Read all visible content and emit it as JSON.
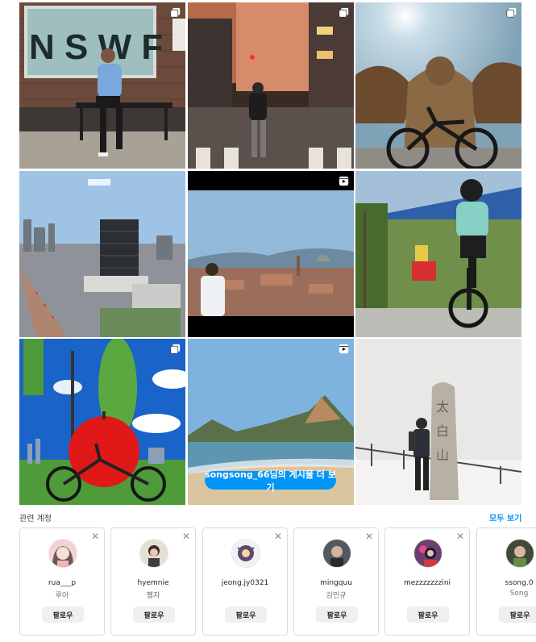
{
  "grid": {
    "posts": [
      {
        "id": "post-1",
        "badge": "carousel-icon",
        "alt_sign": "NSWF"
      },
      {
        "id": "post-2",
        "badge": "carousel-icon"
      },
      {
        "id": "post-3",
        "badge": "carousel-icon"
      },
      {
        "id": "post-4",
        "badge": ""
      },
      {
        "id": "post-5",
        "badge": "reels-icon"
      },
      {
        "id": "post-6",
        "badge": ""
      },
      {
        "id": "post-7",
        "badge": "carousel-icon"
      },
      {
        "id": "post-8",
        "badge": "reels-icon"
      },
      {
        "id": "post-9",
        "badge": ""
      }
    ],
    "more_posts_label": "songsong_66님의 게시물 더 보기"
  },
  "related": {
    "title": "관련 계정",
    "see_all": "모두 보기",
    "accounts": [
      {
        "username": "rua___p",
        "full_name": "루아",
        "follow": "팔로우",
        "avatar_color": "#f3d2cf"
      },
      {
        "username": "hyemnie",
        "full_name": "혭자",
        "follow": "팔로우",
        "avatar_color": "#e4e0d6"
      },
      {
        "username": "jeong.jy0321",
        "full_name": "",
        "follow": "팔로우",
        "avatar_color": "#f4f1f4"
      },
      {
        "username": "mingquu",
        "full_name": "김민규",
        "follow": "팔로우",
        "avatar_color": "#505a62"
      },
      {
        "username": "mezzzzzzzini",
        "full_name": "",
        "follow": "팔로우",
        "avatar_color": "#6b3f6e"
      },
      {
        "username": "ssong.0",
        "full_name": "Song",
        "follow": "팔로우",
        "avatar_color": "#3f4a3a"
      }
    ]
  },
  "colors": {
    "accent": "#0095f6",
    "border": "#dbdbdb",
    "muted": "#737373"
  }
}
